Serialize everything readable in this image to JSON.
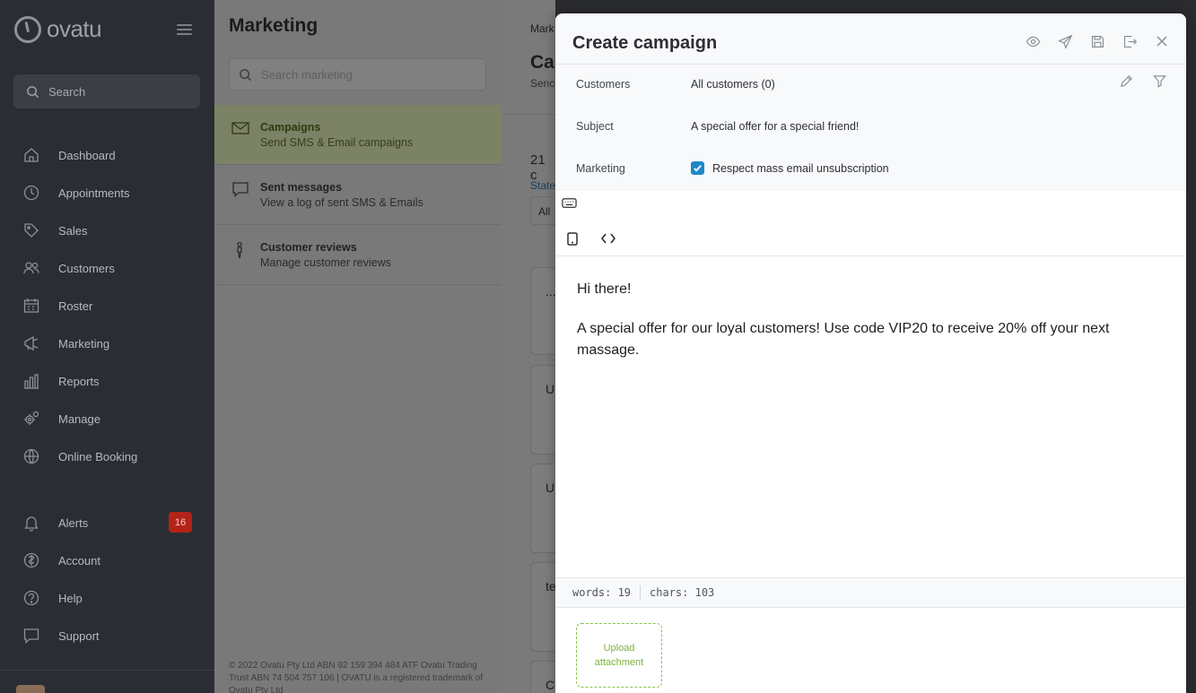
{
  "app": {
    "logo_text": "ovatu"
  },
  "sidebar": {
    "search_label": "Search",
    "items": [
      {
        "label": "Dashboard",
        "icon": "home-icon"
      },
      {
        "label": "Appointments",
        "icon": "clock-icon"
      },
      {
        "label": "Sales",
        "icon": "tag-icon"
      },
      {
        "label": "Customers",
        "icon": "users-icon"
      },
      {
        "label": "Roster",
        "icon": "calendar-icon"
      },
      {
        "label": "Marketing",
        "icon": "megaphone-icon"
      },
      {
        "label": "Reports",
        "icon": "bar-chart-icon"
      },
      {
        "label": "Manage",
        "icon": "gears-icon"
      },
      {
        "label": "Online Booking",
        "icon": "globe-gear-icon"
      }
    ],
    "bottom_items": [
      {
        "label": "Alerts",
        "icon": "bell-icon",
        "badge": "16"
      },
      {
        "label": "Account",
        "icon": "account-icon"
      },
      {
        "label": "Help",
        "icon": "help-icon"
      },
      {
        "label": "Support",
        "icon": "chat-icon"
      }
    ]
  },
  "marketing": {
    "title": "Marketing",
    "search_placeholder": "Search marketing",
    "items": [
      {
        "title": "Campaigns",
        "subtitle": "Send SMS & Email campaigns",
        "icon": "envelope-icon",
        "active": true
      },
      {
        "title": "Sent messages",
        "subtitle": "View a log of sent SMS & Emails",
        "icon": "message-icon",
        "active": false
      },
      {
        "title": "Customer reviews",
        "subtitle": "Manage customer reviews",
        "icon": "person-icon",
        "active": false
      }
    ],
    "footer": "© 2022 Ovatu Pty Ltd ABN 92 159 394 484 ATF Ovatu Trading Trust ABN 74 504 757 106 | OVATU is a registered trademark of Ovatu Pty Ltd"
  },
  "background": {
    "breadcrumb": "Mark",
    "heading": "Ca",
    "subheading": "Senc",
    "count": "21 c",
    "state_label": "State",
    "filter_value": "All",
    "card_letters": [
      "...",
      "U",
      "U",
      "te",
      "C"
    ]
  },
  "modal": {
    "title": "Create campaign",
    "header_icons": [
      "eye-icon",
      "send-icon",
      "save-icon",
      "exit-icon",
      "close-icon"
    ],
    "customers_label": "Customers",
    "customers_value": "All customers (0)",
    "subject_label": "Subject",
    "subject_value": "A special offer for a special friend!",
    "marketing_label": "Marketing",
    "marketing_checkbox_label": "Respect mass email unsubscription",
    "marketing_checked": true,
    "body_paragraphs": [
      "Hi there!",
      "A special offer for our loyal customers! Use code VIP20 to receive 20% off your next massage."
    ],
    "words": "words: 19",
    "chars": "chars: 103",
    "upload_label_1": "Upload",
    "upload_label_2": "attachment"
  },
  "colors": {
    "sidebar_bg": "#2a2d33",
    "accent_green": "#7cb342",
    "checkbox_blue": "#1e88c8",
    "badge_red": "#b42318"
  }
}
